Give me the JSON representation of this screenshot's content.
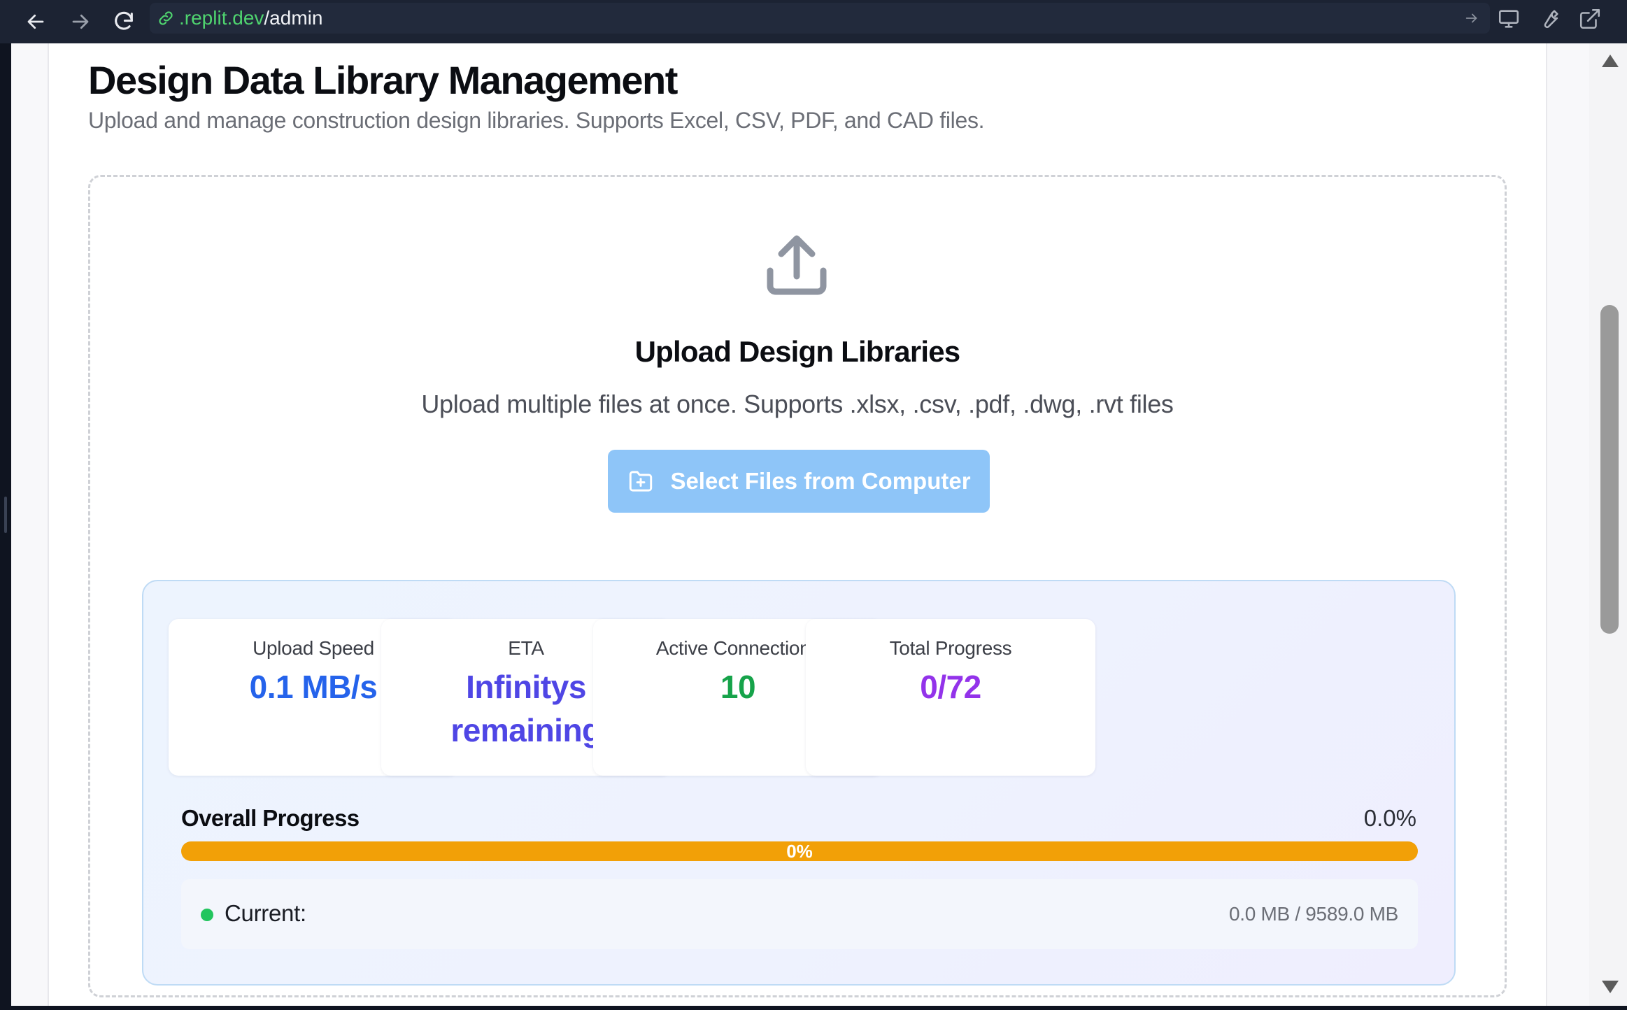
{
  "browser": {
    "url_host": ".replit.dev",
    "url_path": "/admin"
  },
  "header": {
    "title": "Design Data Library Management",
    "subtitle": "Upload and manage construction design libraries. Supports Excel, CSV, PDF, and CAD files."
  },
  "dropzone": {
    "title": "Upload Design Libraries",
    "subtitle": "Upload multiple files at once. Supports .xlsx, .csv, .pdf, .dwg, .rvt files",
    "button_label": "Select Files from Computer"
  },
  "stats": [
    {
      "label": "Upload Speed",
      "value": "0.1 MB/s",
      "color": "#2563eb"
    },
    {
      "label": "ETA",
      "value": "Infinitys remaining",
      "color": "#4f46e5"
    },
    {
      "label": "Active Connections",
      "value": "10",
      "color": "#16a34a"
    },
    {
      "label": "Total Progress",
      "value": "0/72",
      "color": "#9333ea"
    }
  ],
  "overall": {
    "label": "Overall Progress",
    "percent_text": "0.0%",
    "bar_text": "0%",
    "fraction": 0.0
  },
  "current": {
    "label": "Current:",
    "size": "0.0 MB / 9589.0 MB"
  },
  "colors": {
    "accent_button": "#8ec5f8",
    "progress_bar": "#f2a007",
    "status_dot": "#22c55e"
  }
}
